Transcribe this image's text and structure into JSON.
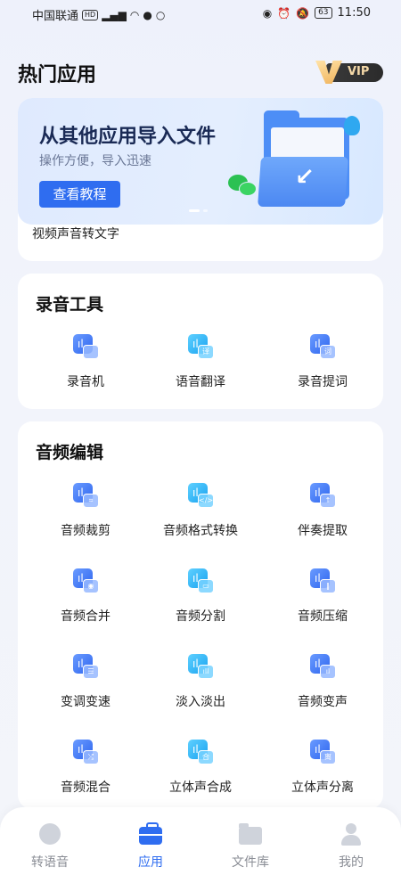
{
  "status_bar": {
    "carrier": "中国联通",
    "hd_badge": "HD",
    "signal_badge": "5G",
    "battery": "63",
    "time": "11:50"
  },
  "header": {
    "title": "热门应用",
    "vip_label": "VIP"
  },
  "banner": {
    "title": "从其他应用导入文件",
    "subtitle": "操作方便，导入迅速",
    "button_label": "查看教程",
    "caption": "视频声音转文字"
  },
  "recording_tools": {
    "title": "录音工具",
    "items": [
      {
        "label": "录音机",
        "icon": "radio-icon",
        "sub": ""
      },
      {
        "label": "语音翻译",
        "icon": "voice-translate-icon",
        "sub": "译"
      },
      {
        "label": "录音提词",
        "icon": "mic-prompt-icon",
        "sub": "词"
      }
    ]
  },
  "audio_editing": {
    "title": "音频编辑",
    "items": [
      {
        "label": "音频裁剪",
        "icon": "audio-crop-icon",
        "sub": "⌗"
      },
      {
        "label": "音频格式转换",
        "icon": "audio-format-icon",
        "sub": "</>"
      },
      {
        "label": "伴奏提取",
        "icon": "accompaniment-icon",
        "sub": "↑"
      },
      {
        "label": "音频合并",
        "icon": "audio-merge-icon",
        "sub": "◉"
      },
      {
        "label": "音频分割",
        "icon": "audio-split-icon",
        "sub": "▭"
      },
      {
        "label": "音频压缩",
        "icon": "audio-compress-icon",
        "sub": "‖"
      },
      {
        "label": "变调变速",
        "icon": "pitch-speed-icon",
        "sub": "☰"
      },
      {
        "label": "淡入淡出",
        "icon": "fade-icon",
        "sub": "ıll"
      },
      {
        "label": "音频变声",
        "icon": "voice-change-icon",
        "sub": "ıl"
      },
      {
        "label": "音频混合",
        "icon": "audio-mix-icon",
        "sub": "⤮"
      },
      {
        "label": "立体声合成",
        "icon": "stereo-merge-icon",
        "sub": "合"
      },
      {
        "label": "立体声分离",
        "icon": "stereo-split-icon",
        "sub": "离"
      }
    ]
  },
  "bottom_nav": {
    "items": [
      {
        "label": "转语音",
        "icon": "ear-icon"
      },
      {
        "label": "应用",
        "icon": "briefcase-icon"
      },
      {
        "label": "文件库",
        "icon": "folder-icon"
      },
      {
        "label": "我的",
        "icon": "person-icon"
      }
    ],
    "active": "应用"
  },
  "colors": {
    "accent": "#2f6df0",
    "background": "#eef1fb",
    "card": "#ffffff"
  }
}
